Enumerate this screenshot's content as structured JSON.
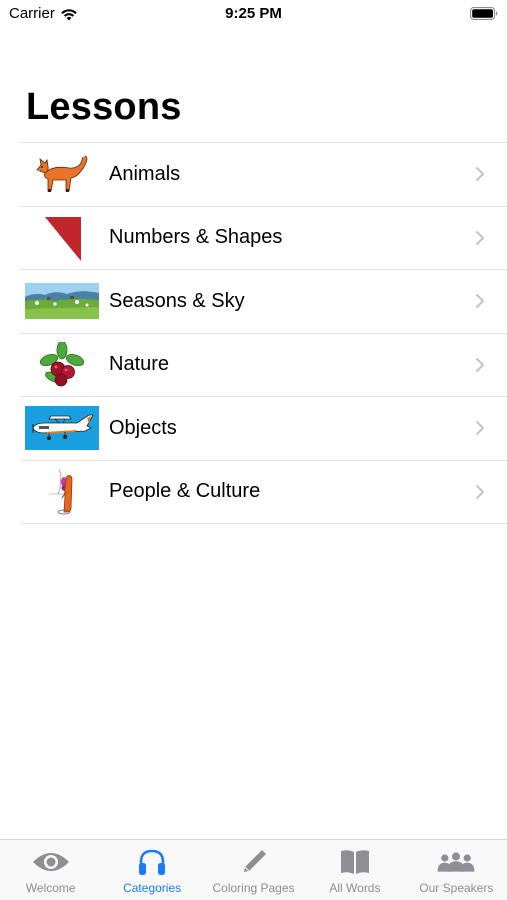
{
  "status_bar": {
    "carrier": "Carrier",
    "time": "9:25 PM"
  },
  "page": {
    "title": "Lessons"
  },
  "lessons": [
    {
      "label": "Animals",
      "icon": "fox-icon"
    },
    {
      "label": "Numbers & Shapes",
      "icon": "triangle-icon"
    },
    {
      "label": "Seasons & Sky",
      "icon": "landscape-icon"
    },
    {
      "label": "Nature",
      "icon": "berries-icon"
    },
    {
      "label": "Objects",
      "icon": "airplane-icon"
    },
    {
      "label": "People & Culture",
      "icon": "person-icon"
    }
  ],
  "tab_bar": {
    "tabs": [
      {
        "label": "Welcome",
        "icon": "eye-icon",
        "active": false
      },
      {
        "label": "Categories",
        "icon": "headphones-icon",
        "active": true
      },
      {
        "label": "Coloring Pages",
        "icon": "pencil-icon",
        "active": false
      },
      {
        "label": "All Words",
        "icon": "book-icon",
        "active": false
      },
      {
        "label": "Our Speakers",
        "icon": "people-icon",
        "active": false
      }
    ]
  },
  "colors": {
    "accent": "#1a7cf5",
    "inactive_tab": "#8e8e93",
    "separator": "#e3e3e6",
    "tab_bar_bg": "#f8f8f8"
  }
}
